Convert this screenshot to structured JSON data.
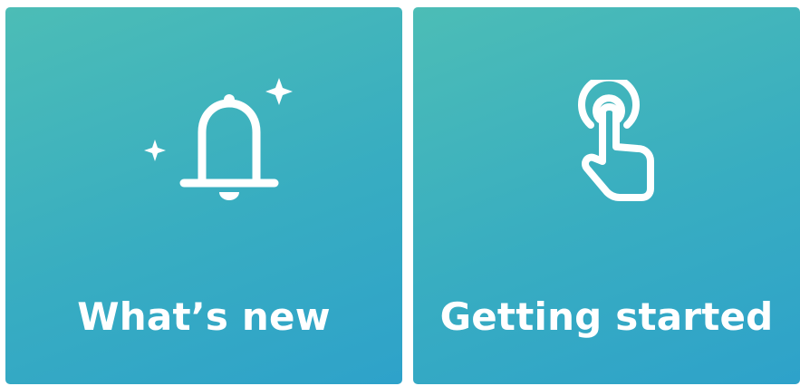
{
  "tiles": [
    {
      "label": "What’s new",
      "icon": "bell-sparkle-icon"
    },
    {
      "label": "Getting started",
      "icon": "tap-hand-icon"
    }
  ],
  "colors": {
    "tile_gradient_start": "#4cbdb6",
    "tile_gradient_end": "#2ea2ca",
    "text": "#ffffff"
  }
}
